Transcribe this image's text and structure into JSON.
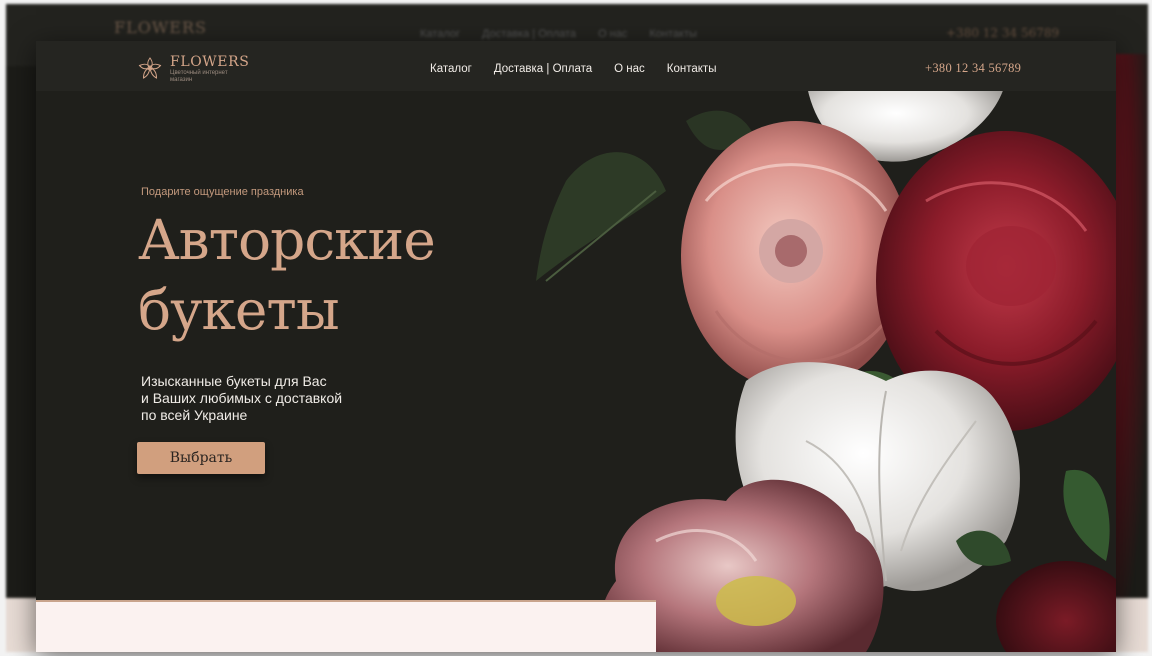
{
  "brand": {
    "name": "FLOWERS",
    "tagline": "Цветочный интернет магазин"
  },
  "nav": {
    "items": [
      {
        "label": "Каталог"
      },
      {
        "label": "Доставка | Оплата"
      },
      {
        "label": "О нас"
      },
      {
        "label": "Контакты"
      }
    ],
    "phone": "+380 12 34 56789"
  },
  "hero": {
    "eyebrow": "Подарите ощущение праздника",
    "title_line1": "Авторские",
    "title_line2": "букеты",
    "description": [
      "Изысканные букеты для Вас",
      "и Ваших любимых с доставкой",
      "по всей Украине"
    ],
    "cta_label": "Выбрать"
  },
  "colors": {
    "background": "#1f1f1b",
    "accent": "#d5a68a",
    "button": "#d19f7e",
    "text_light": "#f0ece7"
  }
}
